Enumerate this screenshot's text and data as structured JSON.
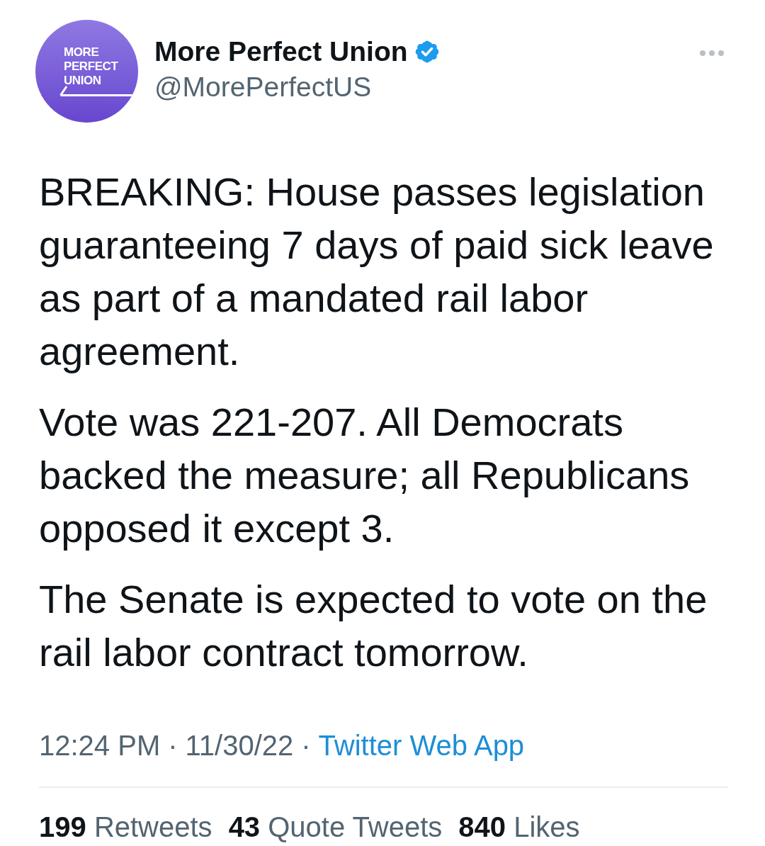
{
  "author": {
    "avatar_text": "MORE PERFECT UNION",
    "name": "More Perfect Union",
    "verified": true,
    "handle": "@MorePerfectUS"
  },
  "body": [
    "BREAKING: House passes legislation guaranteeing 7 days of paid sick leave as part of a mandated rail labor agreement.",
    "Vote was 221-207. All Democrats backed the measure; all Republicans opposed it except 3.",
    "The Senate is expected to vote on the rail labor contract tomorrow."
  ],
  "meta": [
    {
      "kind": "text",
      "text": "12:24 PM"
    },
    {
      "kind": "separator",
      "text": "·"
    },
    {
      "kind": "text",
      "text": "11/30/22"
    },
    {
      "kind": "separator",
      "text": "·"
    },
    {
      "kind": "link",
      "text": "Twitter Web App"
    }
  ],
  "stats": [
    {
      "count": "199",
      "label": "Retweets"
    },
    {
      "count": "43",
      "label": "Quote Tweets"
    },
    {
      "count": "840",
      "label": "Likes"
    }
  ]
}
